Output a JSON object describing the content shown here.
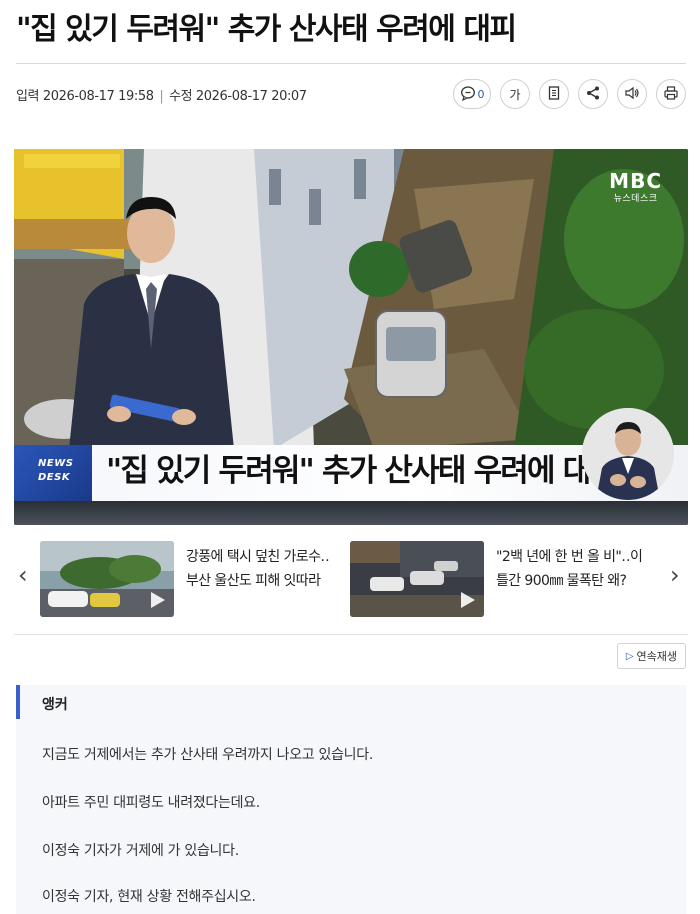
{
  "article": {
    "title": "\"집 있기 두려워\" 추가 산사태 우려에 대피",
    "meta": {
      "input_label": "입력",
      "input_time": "2026-08-17 19:58",
      "edit_label": "수정",
      "edit_time": "2026-08-17 20:07"
    },
    "tools": {
      "comment_count": "0",
      "font_label": "가",
      "icons": [
        "comment-icon",
        "font-size-icon",
        "bookmark-icon",
        "share-icon",
        "speaker-icon",
        "print-icon"
      ]
    }
  },
  "video": {
    "channel_logo": "MBC",
    "channel_sub": "뉴스데스크",
    "badge_line1": "NEWS",
    "badge_line2": "DESK",
    "caption": "\"집 있기 두려워\" 추가 산사태 우려에 대피"
  },
  "related": {
    "prev_icon": "chevron-left-icon",
    "next_icon": "chevron-right-icon",
    "items": [
      {
        "line1": "강풍에 택시 덮친 가로수‥",
        "line2": "부산 울산도 피해 잇따라"
      },
      {
        "line1": "\"2백 년에 한 번 올 비\"‥이",
        "line2": "틀간 900㎜ 물폭탄 왜?"
      }
    ]
  },
  "autoplay_label": "연속재생",
  "body": {
    "section_label": "앵커",
    "paragraphs": [
      "지금도 거제에서는 추가 산사태 우려까지 나오고 있습니다.",
      "아파트 주민 대피령도 내려졌다는데요.",
      "이정숙 기자가 거제에 가 있습니다.",
      "이정숙 기자, 현재 상황 전해주십시오."
    ]
  },
  "colors": {
    "accent": "#3a5fd0",
    "badge_blue": "#2b56b8",
    "body_bg": "#f5f7fa"
  }
}
